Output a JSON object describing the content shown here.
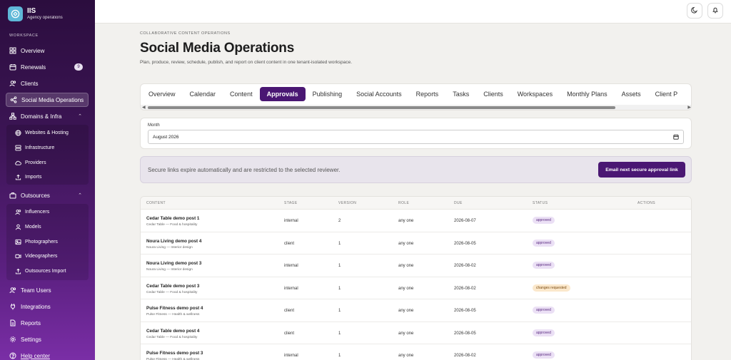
{
  "brand": {
    "name": "IIS",
    "subtitle": "Agency operations"
  },
  "sidebar": {
    "section_label": "WORKSPACE",
    "items": [
      {
        "label": "Overview"
      },
      {
        "label": "Renewals",
        "badge": "9"
      },
      {
        "label": "Clients"
      },
      {
        "label": "Social Media Operations"
      },
      {
        "label": "Domains & Infra"
      },
      {
        "label": "Outsources"
      },
      {
        "label": "Team Users"
      },
      {
        "label": "Integrations"
      },
      {
        "label": "Reports"
      },
      {
        "label": "Settings"
      },
      {
        "label": "Help center"
      }
    ],
    "domains_sub": [
      {
        "label": "Websites & Hosting"
      },
      {
        "label": "Infrastructure"
      },
      {
        "label": "Providers"
      },
      {
        "label": "Imports"
      }
    ],
    "outsources_sub": [
      {
        "label": "Influencers"
      },
      {
        "label": "Models"
      },
      {
        "label": "Photographers"
      },
      {
        "label": "Videographers"
      },
      {
        "label": "Outsources Import"
      }
    ]
  },
  "header": {
    "eyebrow": "COLLABORATIVE CONTENT OPERATIONS",
    "title": "Social Media Operations",
    "description": "Plan, produce, review, schedule, publish, and report on client content in one tenant-isolated workspace."
  },
  "tabs": [
    {
      "label": "Overview"
    },
    {
      "label": "Calendar"
    },
    {
      "label": "Content"
    },
    {
      "label": "Approvals",
      "active": true
    },
    {
      "label": "Publishing"
    },
    {
      "label": "Social Accounts"
    },
    {
      "label": "Reports"
    },
    {
      "label": "Tasks"
    },
    {
      "label": "Clients"
    },
    {
      "label": "Workspaces"
    },
    {
      "label": "Monthly Plans"
    },
    {
      "label": "Assets"
    },
    {
      "label": "Client P"
    }
  ],
  "month": {
    "label": "Month",
    "value": "August 2026"
  },
  "notice": {
    "text": "Secure links expire automatically and are restricted to the selected reviewer.",
    "button": "Email next secure approval link"
  },
  "table": {
    "columns": [
      "CONTENT",
      "STAGE",
      "VERSION",
      "ROLE",
      "DUE",
      "STATUS",
      "ACTIONS"
    ],
    "rows": [
      {
        "title": "Cedar Table demo post 1",
        "sub": "Cedar Table — Food & hospitality",
        "stage": "internal",
        "version": "2",
        "role": "any one",
        "due": "2026-08-07",
        "status": "approved"
      },
      {
        "title": "Noura Living demo post 4",
        "sub": "Noura Living — Interior design",
        "stage": "client",
        "version": "1",
        "role": "any one",
        "due": "2026-08-05",
        "status": "approved"
      },
      {
        "title": "Noura Living demo post 3",
        "sub": "Noura Living — Interior design",
        "stage": "internal",
        "version": "1",
        "role": "any one",
        "due": "2026-08-02",
        "status": "approved"
      },
      {
        "title": "Cedar Table demo post 3",
        "sub": "Cedar Table — Food & hospitality",
        "stage": "internal",
        "version": "1",
        "role": "any one",
        "due": "2026-08-02",
        "status": "changes requested"
      },
      {
        "title": "Pulse Fitness demo post 4",
        "sub": "Pulse Fitness — Health & wellness",
        "stage": "client",
        "version": "1",
        "role": "any one",
        "due": "2026-08-05",
        "status": "approved"
      },
      {
        "title": "Cedar Table demo post 4",
        "sub": "Cedar Table — Food & hospitality",
        "stage": "client",
        "version": "1",
        "role": "any one",
        "due": "2026-08-05",
        "status": "approved"
      },
      {
        "title": "Pulse Fitness demo post 3",
        "sub": "Pulse Fitness — Health & wellness",
        "stage": "internal",
        "version": "1",
        "role": "any one",
        "due": "2026-08-02",
        "status": "approved"
      }
    ]
  }
}
